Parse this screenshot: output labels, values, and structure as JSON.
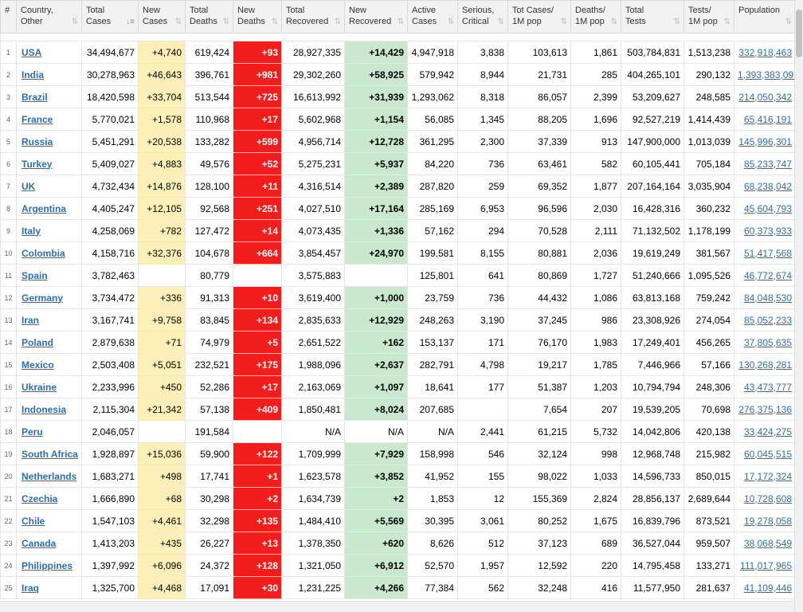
{
  "headers": [
    {
      "label": "#",
      "sorted": false,
      "sortable": false
    },
    {
      "label": "Country,\nOther",
      "sorted": false,
      "sortable": true
    },
    {
      "label": "Total\nCases",
      "sorted": true,
      "sortable": true
    },
    {
      "label": "New\nCases",
      "sorted": false,
      "sortable": true
    },
    {
      "label": "Total\nDeaths",
      "sorted": false,
      "sortable": true
    },
    {
      "label": "New\nDeaths",
      "sorted": false,
      "sortable": true
    },
    {
      "label": "Total\nRecovered",
      "sorted": false,
      "sortable": true
    },
    {
      "label": "New\nRecovered",
      "sorted": false,
      "sortable": true
    },
    {
      "label": "Active\nCases",
      "sorted": false,
      "sortable": true
    },
    {
      "label": "Serious,\nCritical",
      "sorted": false,
      "sortable": true
    },
    {
      "label": "Tot Cases/\n1M pop",
      "sorted": false,
      "sortable": true
    },
    {
      "label": "Deaths/\n1M pop",
      "sorted": false,
      "sortable": true
    },
    {
      "label": "Total\nTests",
      "sorted": false,
      "sortable": true
    },
    {
      "label": "Tests/\n1M pop",
      "sorted": false,
      "sortable": true
    },
    {
      "label": "Population",
      "sorted": false,
      "sortable": true
    }
  ],
  "sort_icon": "sort-arrows-icon",
  "colors": {
    "new_cases_bg": "#fcf0b8",
    "new_deaths_bg": "#f21e1e",
    "new_recovered_bg": "#c9e8cd",
    "link": "#2f6ea8"
  },
  "rows": [
    [
      "1",
      "USA",
      "34,494,677",
      "+4,740",
      "619,424",
      "+93",
      "28,927,335",
      "+14,429",
      "4,947,918",
      "3,838",
      "103,613",
      "1,861",
      "503,784,831",
      "1,513,238",
      "332,918,463"
    ],
    [
      "2",
      "India",
      "30,278,963",
      "+46,643",
      "396,761",
      "+981",
      "29,302,260",
      "+58,925",
      "579,942",
      "8,944",
      "21,731",
      "285",
      "404,265,101",
      "290,132",
      "1,393,383,096"
    ],
    [
      "3",
      "Brazil",
      "18,420,598",
      "+33,704",
      "513,544",
      "+725",
      "16,613,992",
      "+31,939",
      "1,293,062",
      "8,318",
      "86,057",
      "2,399",
      "53,209,627",
      "248,585",
      "214,050,342"
    ],
    [
      "4",
      "France",
      "5,770,021",
      "+1,578",
      "110,968",
      "+17",
      "5,602,968",
      "+1,154",
      "56,085",
      "1,345",
      "88,205",
      "1,696",
      "92,527,219",
      "1,414,439",
      "65,416,191"
    ],
    [
      "5",
      "Russia",
      "5,451,291",
      "+20,538",
      "133,282",
      "+599",
      "4,956,714",
      "+12,728",
      "361,295",
      "2,300",
      "37,339",
      "913",
      "147,900,000",
      "1,013,039",
      "145,996,301"
    ],
    [
      "6",
      "Turkey",
      "5,409,027",
      "+4,883",
      "49,576",
      "+52",
      "5,275,231",
      "+5,937",
      "84,220",
      "736",
      "63,461",
      "582",
      "60,105,441",
      "705,184",
      "85,233,747"
    ],
    [
      "7",
      "UK",
      "4,732,434",
      "+14,876",
      "128,100",
      "+11",
      "4,316,514",
      "+2,389",
      "287,820",
      "259",
      "69,352",
      "1,877",
      "207,164,164",
      "3,035,904",
      "68,238,042"
    ],
    [
      "8",
      "Argentina",
      "4,405,247",
      "+12,105",
      "92,568",
      "+251",
      "4,027,510",
      "+17,164",
      "285,169",
      "6,953",
      "96,596",
      "2,030",
      "16,428,316",
      "360,232",
      "45,604,793"
    ],
    [
      "9",
      "Italy",
      "4,258,069",
      "+782",
      "127,472",
      "+14",
      "4,073,435",
      "+1,336",
      "57,162",
      "294",
      "70,528",
      "2,111",
      "71,132,502",
      "1,178,199",
      "60,373,933"
    ],
    [
      "10",
      "Colombia",
      "4,158,716",
      "+32,376",
      "104,678",
      "+664",
      "3,854,457",
      "+24,970",
      "199,581",
      "8,155",
      "80,881",
      "2,036",
      "19,619,249",
      "381,567",
      "51,417,568"
    ],
    [
      "11",
      "Spain",
      "3,782,463",
      "",
      "80,779",
      "",
      "3,575,883",
      "",
      "125,801",
      "641",
      "80,869",
      "1,727",
      "51,240,666",
      "1,095,526",
      "46,772,674"
    ],
    [
      "12",
      "Germany",
      "3,734,472",
      "+336",
      "91,313",
      "+10",
      "3,619,400",
      "+1,000",
      "23,759",
      "736",
      "44,432",
      "1,086",
      "63,813,168",
      "759,242",
      "84,048,530"
    ],
    [
      "13",
      "Iran",
      "3,167,741",
      "+9,758",
      "83,845",
      "+134",
      "2,835,633",
      "+12,929",
      "248,263",
      "3,190",
      "37,245",
      "986",
      "23,308,926",
      "274,054",
      "85,052,233"
    ],
    [
      "14",
      "Poland",
      "2,879,638",
      "+71",
      "74,979",
      "+5",
      "2,651,522",
      "+162",
      "153,137",
      "171",
      "76,170",
      "1,983",
      "17,249,401",
      "456,265",
      "37,805,635"
    ],
    [
      "15",
      "Mexico",
      "2,503,408",
      "+5,051",
      "232,521",
      "+175",
      "1,988,096",
      "+2,637",
      "282,791",
      "4,798",
      "19,217",
      "1,785",
      "7,446,966",
      "57,166",
      "130,268,281"
    ],
    [
      "16",
      "Ukraine",
      "2,233,996",
      "+450",
      "52,286",
      "+17",
      "2,163,069",
      "+1,097",
      "18,641",
      "177",
      "51,387",
      "1,203",
      "10,794,794",
      "248,306",
      "43,473,777"
    ],
    [
      "17",
      "Indonesia",
      "2,115,304",
      "+21,342",
      "57,138",
      "+409",
      "1,850,481",
      "+8,024",
      "207,685",
      "",
      "7,654",
      "207",
      "19,539,205",
      "70,698",
      "276,375,136"
    ],
    [
      "18",
      "Peru",
      "2,046,057",
      "",
      "191,584",
      "",
      "N/A",
      "N/A",
      "N/A",
      "2,441",
      "61,215",
      "5,732",
      "14,042,806",
      "420,138",
      "33,424,275"
    ],
    [
      "19",
      "South Africa",
      "1,928,897",
      "+15,036",
      "59,900",
      "+122",
      "1,709,999",
      "+7,929",
      "158,998",
      "546",
      "32,124",
      "998",
      "12,968,748",
      "215,982",
      "60,045,515"
    ],
    [
      "20",
      "Netherlands",
      "1,683,271",
      "+498",
      "17,741",
      "+1",
      "1,623,578",
      "+3,852",
      "41,952",
      "155",
      "98,022",
      "1,033",
      "14,596,733",
      "850,015",
      "17,172,324"
    ],
    [
      "21",
      "Czechia",
      "1,666,890",
      "+68",
      "30,298",
      "+2",
      "1,634,739",
      "+2",
      "1,853",
      "12",
      "155,369",
      "2,824",
      "28,856,137",
      "2,689,644",
      "10,728,608"
    ],
    [
      "22",
      "Chile",
      "1,547,103",
      "+4,461",
      "32,298",
      "+135",
      "1,484,410",
      "+5,569",
      "30,395",
      "3,061",
      "80,252",
      "1,675",
      "16,839,796",
      "873,521",
      "19,278,058"
    ],
    [
      "23",
      "Canada",
      "1,413,203",
      "+435",
      "26,227",
      "+13",
      "1,378,350",
      "+620",
      "8,626",
      "512",
      "37,123",
      "689",
      "36,527,044",
      "959,507",
      "38,068,549"
    ],
    [
      "24",
      "Philippines",
      "1,397,992",
      "+6,096",
      "24,372",
      "+128",
      "1,321,050",
      "+6,912",
      "52,570",
      "1,957",
      "12,592",
      "220",
      "14,795,458",
      "133,271",
      "111,017,965"
    ],
    [
      "25",
      "Iraq",
      "1,325,700",
      "+4,468",
      "17,091",
      "+30",
      "1,231,225",
      "+4,266",
      "77,384",
      "562",
      "32,248",
      "416",
      "11,577,950",
      "281,637",
      "41,109,446"
    ]
  ]
}
